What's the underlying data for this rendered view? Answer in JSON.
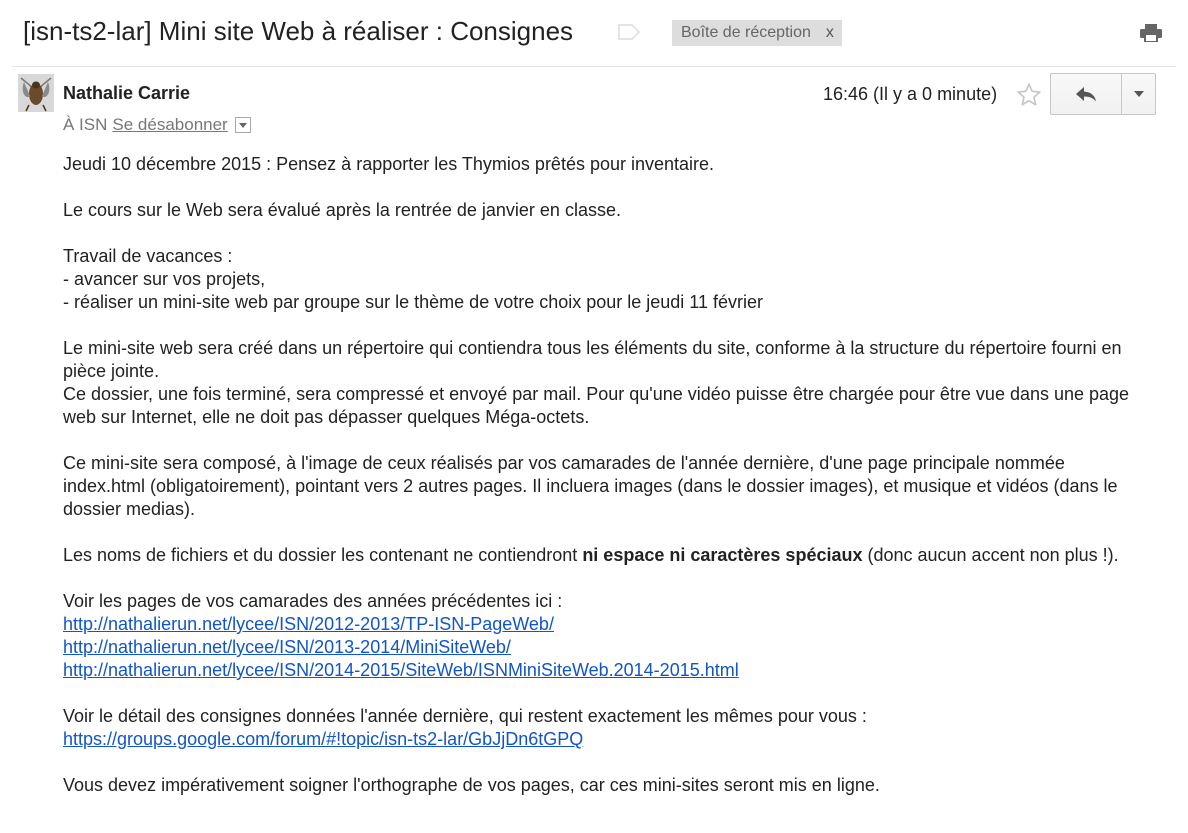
{
  "header": {
    "subject": "[isn-ts2-lar] Mini site Web à réaliser : Consignes",
    "label": "Boîte de réception",
    "label_remove": "x"
  },
  "message": {
    "sender": "Nathalie Carrie",
    "to_prefix": "À ISN",
    "unsubscribe": "Se désabonner",
    "time": "16:46 (Il y a 0 minute)"
  },
  "body": {
    "p1": "Jeudi 10 décembre 2015 : Pensez à rapporter les Thymios prêtés pour inventaire.",
    "p2": "Le cours sur le Web sera évalué après la rentrée de janvier en classe.",
    "p3_l1": "Travail de vacances :",
    "p3_l2": "- avancer sur vos projets,",
    "p3_l3": "- réaliser un mini-site web par groupe sur le thème de votre choix pour le jeudi 11 février",
    "p4_a": "Le mini-site web sera créé dans un répertoire qui contiendra tous les éléments du site, conforme à la structure du répertoire fourni en pièce jointe.",
    "p4_b": "Ce dossier, une fois terminé, sera compressé et envoyé par mail. Pour qu'une vidéo puisse être chargée pour être vue dans une page web sur Internet, elle ne doit pas dépasser quelques Méga-octets.",
    "p5": "Ce mini-site sera composé, à l'image de ceux réalisés par vos camarades de l'année dernière, d'une page principale nommée index.html (obligatoirement), pointant vers 2 autres pages. Il incluera images (dans le dossier images), et musique et vidéos (dans le dossier medias).",
    "p6_before": "Les noms de fichiers et du dossier les contenant ne contiendront ",
    "p6_bold": "ni espace ni caractères spéciaux",
    "p6_after": " (donc aucun accent non plus !).",
    "p7_intro": "Voir les pages de vos camarades des années précédentes ici :",
    "links": [
      "http://nathalierun.net/lycee/ISN/2012-2013/TP-ISN-PageWeb/",
      "http://nathalierun.net/lycee/ISN/2013-2014/MiniSiteWeb/",
      "http://nathalierun.net/lycee/ISN/2014-2015/SiteWeb/ISNMiniSiteWeb.2014-2015.html"
    ],
    "p8_intro": "Voir le détail des consignes données l'année dernière, qui restent exactement les mêmes pour vous :",
    "p8_link": "https://groups.google.com/forum/#!topic/isn-ts2-lar/GbJjDn6tGPQ",
    "p9": "Vous devez impérativement soigner l'orthographe de vos pages, car ces mini-sites seront mis en ligne."
  },
  "icons": {
    "importance": "importance-marker-icon",
    "print": "print-icon",
    "star": "star-icon",
    "reply": "reply-icon",
    "more": "chevron-down-icon"
  },
  "colors": {
    "link": "#1155cc",
    "label_bg": "#dddddd",
    "meta_text": "#777777"
  }
}
